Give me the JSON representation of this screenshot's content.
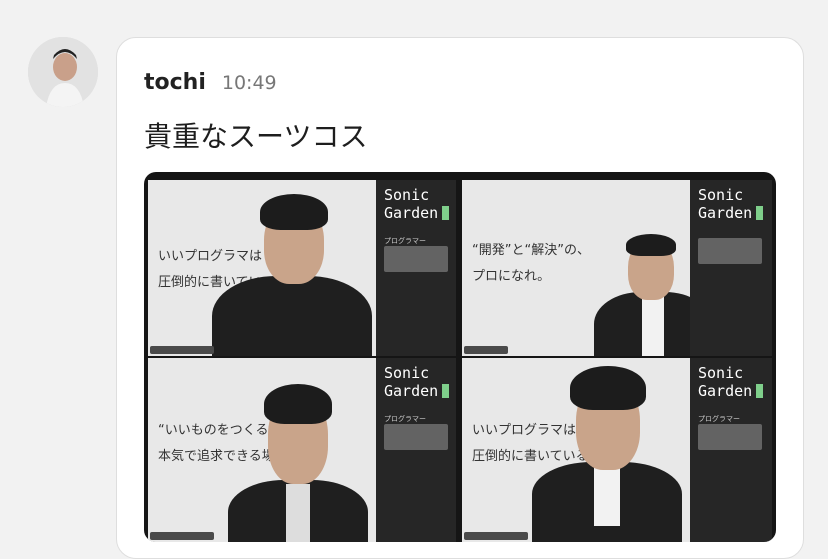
{
  "message": {
    "author": "tochi",
    "time": "10:49",
    "text": "貴重なスーツコス"
  },
  "image": {
    "tiles": [
      {
        "brand_line1": "Sonic",
        "brand_line2": "Garden",
        "role_label": "プログラマー",
        "slide_line1": "いいプログラマは",
        "slide_line2": "圧倒的に書いてい"
      },
      {
        "brand_line1": "Sonic",
        "brand_line2": "Garden",
        "role_label": "",
        "slide_line1": "“開発”と“解決”の、",
        "slide_line2": "プロになれ。"
      },
      {
        "brand_line1": "Sonic",
        "brand_line2": "Garden",
        "role_label": "プログラマー",
        "slide_line1": "“いいものをつくる”",
        "slide_line2": "本気で追求できる場所"
      },
      {
        "brand_line1": "Sonic",
        "brand_line2": "Garden",
        "role_label": "プログラマー",
        "slide_line1": "いいプログラマは",
        "slide_line2": "圧倒的に書いている"
      }
    ]
  },
  "colors": {
    "accent_green": "#7fcf8b",
    "panel_dark": "#262626"
  }
}
